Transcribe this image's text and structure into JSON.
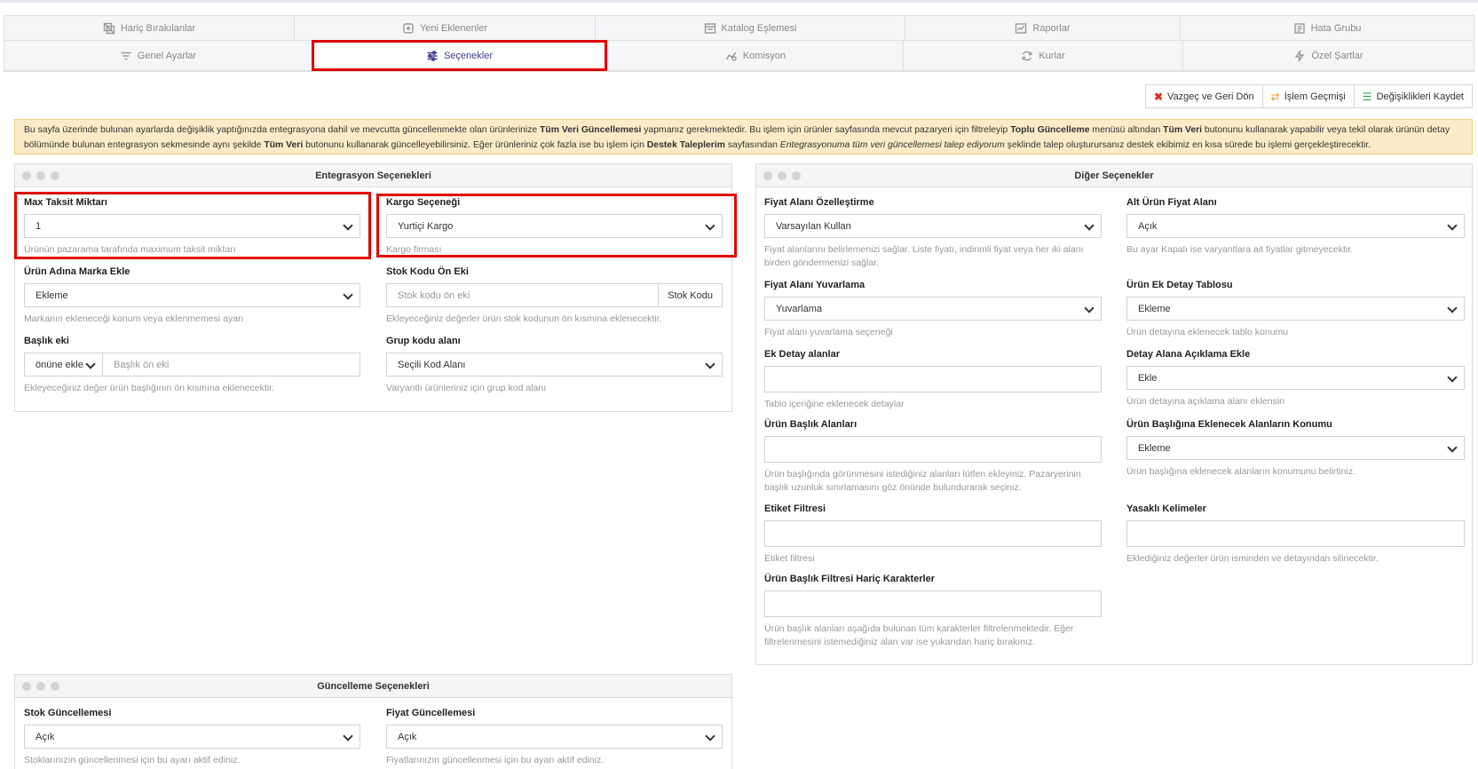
{
  "tabs_row1": [
    {
      "label": "Hariç Bırakılanlar",
      "icon": "exclude-icon"
    },
    {
      "label": "Yeni Eklenenler",
      "icon": "new-item-icon"
    },
    {
      "label": "Katalog Eşlemesi",
      "icon": "catalog-icon"
    },
    {
      "label": "Raporlar",
      "icon": "report-icon"
    },
    {
      "label": "Hata Grubu",
      "icon": "error-group-icon"
    }
  ],
  "tabs_row2": [
    {
      "label": "Genel Ayarlar",
      "icon": "filter-icon"
    },
    {
      "label": "Seçenekler",
      "icon": "sliders-icon"
    },
    {
      "label": "Komisyon",
      "icon": "chart-icon"
    },
    {
      "label": "Kurlar",
      "icon": "refresh-icon"
    },
    {
      "label": "Özel Şartlar",
      "icon": "bolt-icon"
    }
  ],
  "actions": {
    "cancel": "Vazgeç ve Geri Dön",
    "history": "İşlem Geçmişi",
    "save": "Değişiklikleri Kaydet"
  },
  "alert": {
    "t1": "Bu sayfa üzerinde bulunan ayarlarda değişiklik yaptığınızda entegrasyona dahil ve mevcutta güncellenmekte olan ürünlerinize ",
    "b1": "Tüm Veri Güncellemesi",
    "t2": " yapmanız gerekmektedir. Bu işlem için ürünler sayfasında mevcut pazaryeri için filtreleyip ",
    "b2": "Toplu Güncelleme",
    "t3": " menüsü altından ",
    "b3": "Tüm Veri",
    "t4": " butonunu kullanarak yapabilir veya tekil olarak ürünün detay bölümünde bulunan entegrasyon sekmesinde aynı şekilde ",
    "b4": "Tüm Veri",
    "t5": " butonunu kullanarak güncelleyebilirsiniz. Eğer ürünleriniz çok fazla ise bu işlem için ",
    "b5": "Destek Taleplerim",
    "t6": " sayfasından ",
    "i1": "Entegrasyonuma tüm veri güncellemesi talep ediyorum",
    "t7": " şeklinde talep oluşturursanız destek ekibimiz en kısa sürede bu işlemi gerçekleştirecektir."
  },
  "integration_panel": {
    "title": "Entegrasyon Seçenekleri",
    "max_installment": {
      "label": "Max Taksit Miktarı",
      "value": "1",
      "help": "Ürünün pazarama tarafında maximum taksit miktarı"
    },
    "cargo": {
      "label": "Kargo Seçeneği",
      "value": "Yurtiçi Kargo",
      "help": "Kargo firması"
    },
    "brand": {
      "label": "Ürün Adına Marka Ekle",
      "value": "Ekleme",
      "help": "Markanın ekleneceği konum veya eklenmemesi ayarı"
    },
    "stock_prefix": {
      "label": "Stok Kodu Ön Eki",
      "placeholder": "Stok kodu ön eki",
      "addon": "Stok Kodu",
      "help": "Ekleyeceğiniz değerler ürün stok kodunun ön kısmına eklenecektir."
    },
    "title_suffix": {
      "label": "Başlık eki",
      "position": "önüne ekle",
      "placeholder": "Başlık ön eki",
      "help": "Ekleyeceğiniz değer ürün başlığının ön kısmına eklenecektir."
    },
    "group_code": {
      "label": "Grup kodu alanı",
      "value": "Seçili Kod Alanı",
      "help": "Varyantlı ürünleriniz için grup kod alanı"
    }
  },
  "other_panel": {
    "title": "Diğer Seçenekler",
    "price_custom": {
      "label": "Fiyat Alanı Özelleştirme",
      "value": "Varsayılan Kullan",
      "help": "Fiyat alanlarını belirlemenizi sağlar. Liste fiyatı, indirimli fiyat veya her iki alanı birden göndermenizi sağlar."
    },
    "sub_price": {
      "label": "Alt Ürün Fiyat Alanı",
      "value": "Açık",
      "help": "Bu ayar Kapalı ise varyantlara ait fiyatlar gitmeyecektir."
    },
    "price_round": {
      "label": "Fiyat Alanı Yuvarlama",
      "value": "Yuvarlama",
      "help": "Fiyat alanı yuvarlama seçeneği"
    },
    "detail_table": {
      "label": "Ürün Ek Detay Tablosu",
      "value": "Ekleme",
      "help": "Ürün detayına eklenecek tablo konumu"
    },
    "extra_detail": {
      "label": "Ek Detay alanlar",
      "help": "Tablo içeriğine eklenecek detaylar"
    },
    "detail_desc": {
      "label": "Detay Alana Açıklama Ekle",
      "value": "Ekle",
      "help": "Ürün detayına açıklama alanı eklensin"
    },
    "title_fields": {
      "label": "Ürün Başlık Alanları",
      "help": "Ürün başlığında görünmesini istediğiniz alanları lütfen ekleyiniz. Pazaryerinin başlık uzunluk sınırlamasını göz önünde bulundurarak seçiniz."
    },
    "title_fields_pos": {
      "label": "Ürün Başlığına Eklenecek Alanların Konumu",
      "value": "Ekleme",
      "help": "Ürün başlığına eklenecek alanların konumunu belirtiniz."
    },
    "tag_filter": {
      "label": "Etiket Filtresi",
      "help": "Etiket filtresi"
    },
    "banned_words": {
      "label": "Yasaklı Kelimeler",
      "help": "Eklediğiniz değerler ürün isminden ve detayından silinecektir."
    },
    "title_filter_excl": {
      "label": "Ürün Başlık Filtresi Hariç Karakterler",
      "help": "Ürün başlık alanları aşağıda bulunan tüm karakterler filtrelenmektedir. Eğer filtrelenmesini istemediğiniz alan var ise yukarıdan hariç bırakınız."
    }
  },
  "update_panel": {
    "title": "Güncelleme Seçenekleri",
    "stock": {
      "label": "Stok Güncellemesi",
      "value": "Açık",
      "help": "Stoklarınızın güncellenmesi için bu ayarı aktif ediniz."
    },
    "price": {
      "label": "Fiyat Güncellemesi",
      "value": "Açık",
      "help": "Fiyatlarınızın güncellenmesi için bu ayarı aktif ediniz."
    }
  },
  "colors": {
    "accent": "#3d3f8f",
    "highlight": "#e10000",
    "alert_bg": "#fcebc6"
  }
}
